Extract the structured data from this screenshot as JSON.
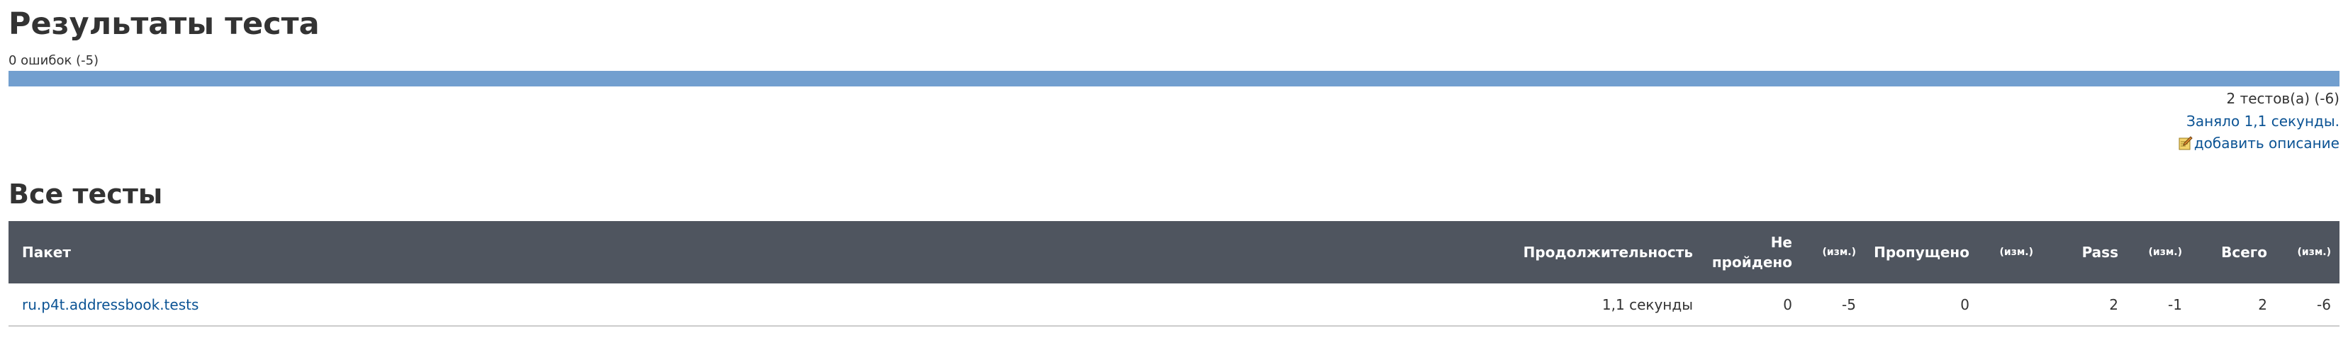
{
  "header": {
    "title": "Результаты теста",
    "failures_summary": "0 ошибок (-5)"
  },
  "health_bar": {
    "pass_fraction": 1.0,
    "color": "#729fcf"
  },
  "meta": {
    "tests_count": "2 тестов(а) (-6)",
    "duration": "Заняло 1,1 секунды.",
    "add_description": "добавить описание",
    "add_description_icon": "edit-description-icon"
  },
  "section": {
    "title": "Все тесты"
  },
  "table": {
    "headers": {
      "package": "Пакет",
      "duration": "Продолжительность",
      "failed_line1": "Не",
      "failed_line2": "пройдено",
      "failed_diff": "(изм.)",
      "skipped": "Пропущено",
      "skipped_diff": "(изм.)",
      "pass": "Pass",
      "pass_diff": "(изм.)",
      "total": "Всего",
      "total_diff": "(изм.)"
    },
    "rows": [
      {
        "package": "ru.p4t.addressbook.tests",
        "duration": "1,1 секунды",
        "failed": "0",
        "failed_diff": "-5",
        "skipped": "0",
        "skipped_diff": "",
        "pass": "2",
        "pass_diff": "-1",
        "total": "2",
        "total_diff": "-6"
      }
    ]
  },
  "colors": {
    "link": "#0b5394",
    "table_header_bg": "#4f555f"
  }
}
